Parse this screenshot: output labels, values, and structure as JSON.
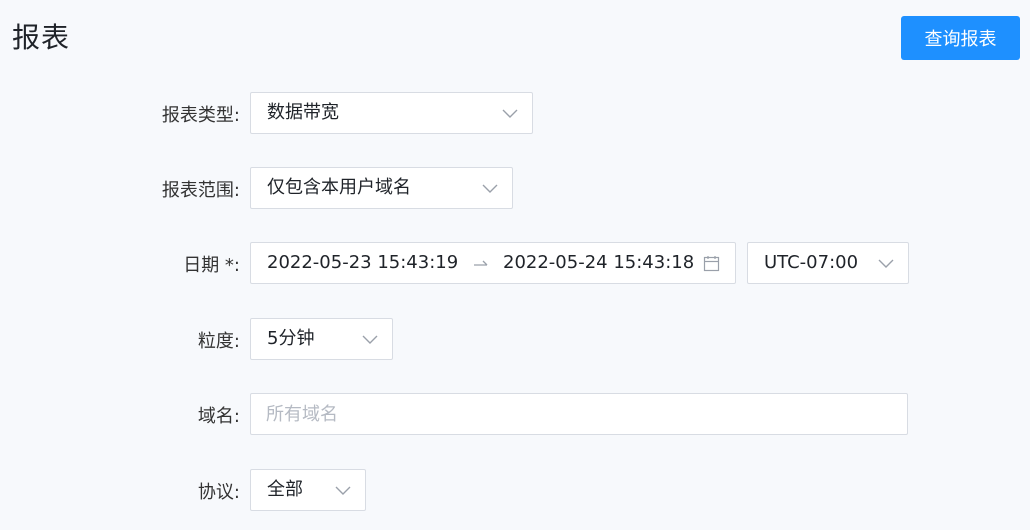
{
  "header": {
    "title": "报表",
    "query_button": "查询报表"
  },
  "form": {
    "report_type": {
      "label": "报表类型:",
      "value": "数据带宽"
    },
    "report_scope": {
      "label": "报表范围:",
      "value": "仅包含本用户域名"
    },
    "date": {
      "label": "日期 *:",
      "start": "2022-05-23 15:43:19",
      "end": "2022-05-24 15:43:18",
      "timezone": "UTC-07:00"
    },
    "granularity": {
      "label": "粒度:",
      "value": "5分钟"
    },
    "domain": {
      "label": "域名:",
      "placeholder": "所有域名",
      "value": ""
    },
    "protocol": {
      "label": "协议:",
      "value": "全部"
    }
  },
  "icons": {
    "dropdown": "chevron-down-icon",
    "range_separator": "arrow-right-icon",
    "calendar": "calendar-icon"
  },
  "colors": {
    "primary": "#1e90ff",
    "background": "#f7f9fc",
    "border": "#d8dce3"
  }
}
